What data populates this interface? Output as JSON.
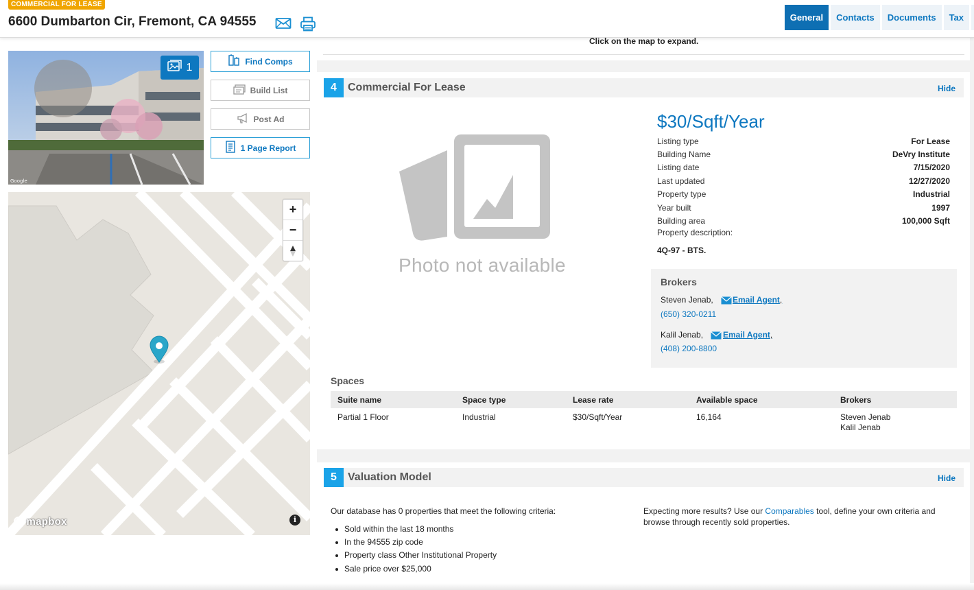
{
  "header": {
    "badge": "COMMERCIAL FOR LEASE",
    "address": "6600 Dumbarton Cir, Fremont, CA 94555",
    "icons": [
      "envelope-icon",
      "printer-icon"
    ],
    "tabs": [
      {
        "label": "General",
        "active": true
      },
      {
        "label": "Contacts",
        "active": false
      },
      {
        "label": "Documents",
        "active": false
      },
      {
        "label": "Tax",
        "active": false
      }
    ]
  },
  "sidebar": {
    "photo_count": "1",
    "buttons": {
      "find_comps": "Find Comps",
      "build_list": "Build List",
      "post_ad": "Post Ad",
      "page_report": "1 Page Report"
    },
    "map": {
      "zoom_in": "+",
      "zoom_out": "−",
      "attribution": "mapbox",
      "info": "i"
    }
  },
  "map_note": "Click on the map to expand.",
  "lease_section": {
    "number": "4",
    "title": "Commercial For Lease",
    "hide": "Hide",
    "photo_placeholder": "Photo not available",
    "price": "$30/Sqft/Year",
    "details": [
      {
        "label": "Listing type",
        "value": "For Lease"
      },
      {
        "label": "Building Name",
        "value": "DeVry Institute"
      },
      {
        "label": "Listing date",
        "value": "7/15/2020"
      },
      {
        "label": "Last updated",
        "value": "12/27/2020"
      },
      {
        "label": "Property type",
        "value": "Industrial"
      },
      {
        "label": "Year built",
        "value": "1997"
      },
      {
        "label": "Building area",
        "value": "100,000 Sqft"
      }
    ],
    "description_label": "Property description:",
    "description": "4Q-97 - BTS.",
    "brokers": {
      "title": "Brokers",
      "list": [
        {
          "name": "Steven Jenab,",
          "email_label": "Email Agent",
          "sep": ",",
          "phone": "(650) 320-0211"
        },
        {
          "name": "Kalil Jenab,",
          "email_label": "Email Agent",
          "sep": ",",
          "phone": "(408) 200-8800"
        }
      ]
    },
    "spaces": {
      "title": "Spaces",
      "columns": [
        "Suite name",
        "Space type",
        "Lease rate",
        "Available space",
        "Brokers"
      ],
      "rows": [
        {
          "suite": "Partial 1 Floor",
          "type": "Industrial",
          "rate": "$30/Sqft/Year",
          "available": "16,164",
          "brokers": [
            "Steven Jenab",
            "Kalil Jenab"
          ]
        }
      ]
    }
  },
  "valuation_section": {
    "number": "5",
    "title": "Valuation Model",
    "hide": "Hide",
    "intro": "Our database has 0 properties that meet the following criteria:",
    "criteria": [
      "Sold within the last 18 months",
      "In the 94555 zip code",
      "Property class Other Institutional Property",
      "Sale price over $25,000"
    ],
    "note_pre": "Expecting more results? Use our ",
    "note_link": "Comparables",
    "note_post": " tool, define your own criteria and browse through recently sold properties."
  },
  "colors": {
    "accent_blue": "#0e78c0",
    "section_number": "#1aa3e8",
    "badge_orange": "#f0a500",
    "map_pin": "#2aa6c9"
  }
}
